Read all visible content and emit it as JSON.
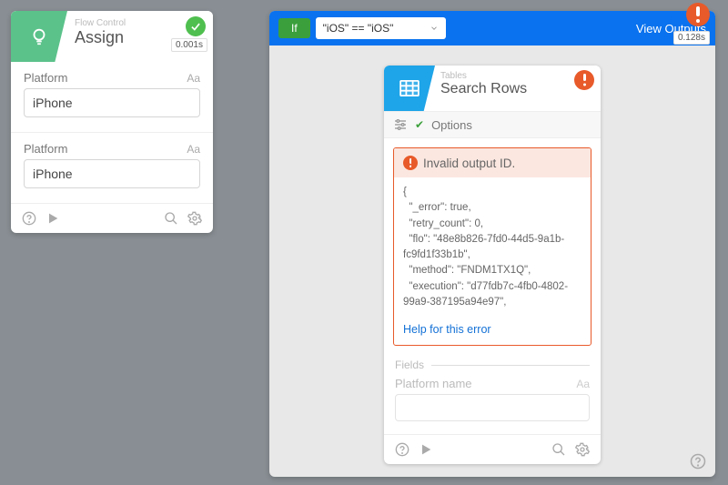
{
  "assign": {
    "category": "Flow Control",
    "title": "Assign",
    "timing": "0.001s",
    "field_label": "Platform",
    "field_type": "Aa",
    "field_value": "iPhone"
  },
  "container": {
    "if_label": "If",
    "condition": "\"iOS\" == \"iOS\"",
    "view_outputs": "View Outputs",
    "timing": "0.128s"
  },
  "search_rows": {
    "category": "Tables",
    "title": "Search Rows",
    "options_label": "Options",
    "error_title": "Invalid output ID.",
    "error_body": "{\n  \"_error\": true,\n  \"retry_count\": 0,\n  \"flo\": \"48e8b826-7fd0-44d5-9a1b-fc9fd1f33b1b\",\n  \"method\": \"FNDM1TX1Q\",\n  \"execution\": \"d77fdb7c-4fb0-4802-99a9-387195a94e97\",",
    "help_link": "Help for this error",
    "fields_legend": "Fields",
    "platform_name_label": "Platform name",
    "field_type": "Aa"
  }
}
